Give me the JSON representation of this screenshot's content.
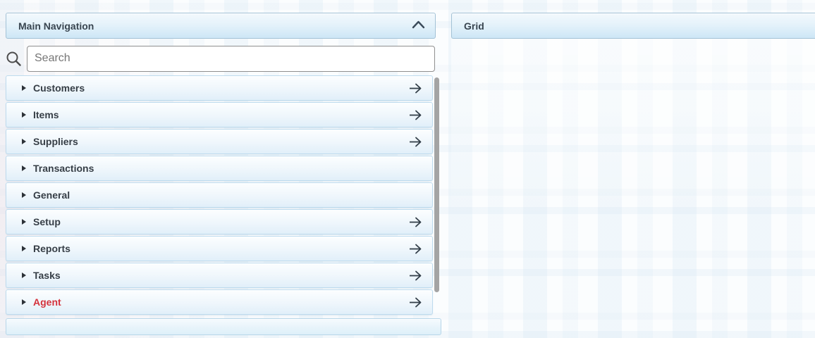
{
  "left_panel": {
    "title": "Main Navigation",
    "collapse_icon": "chevron-up-icon",
    "search": {
      "placeholder": "Search",
      "icon": "search-icon"
    },
    "items": [
      {
        "label": "Customers",
        "has_arrow": true,
        "highlight": false
      },
      {
        "label": "Items",
        "has_arrow": true,
        "highlight": false
      },
      {
        "label": "Suppliers",
        "has_arrow": true,
        "highlight": false
      },
      {
        "label": "Transactions",
        "has_arrow": false,
        "highlight": false
      },
      {
        "label": "General",
        "has_arrow": false,
        "highlight": false
      },
      {
        "label": "Setup",
        "has_arrow": true,
        "highlight": false
      },
      {
        "label": "Reports",
        "has_arrow": true,
        "highlight": false
      },
      {
        "label": "Tasks",
        "has_arrow": true,
        "highlight": false
      },
      {
        "label": "Agent",
        "has_arrow": true,
        "highlight": true
      }
    ]
  },
  "right_panel": {
    "title": "Grid"
  },
  "colors": {
    "highlight_red": "#d4323c",
    "header_text": "#394550",
    "label_text": "#363e46",
    "arrow": "#333f49",
    "header_gradient_bottom": "#cde6f6",
    "row_border": "#bedbee",
    "scrollbar_thumb": "#a4a4a4"
  }
}
